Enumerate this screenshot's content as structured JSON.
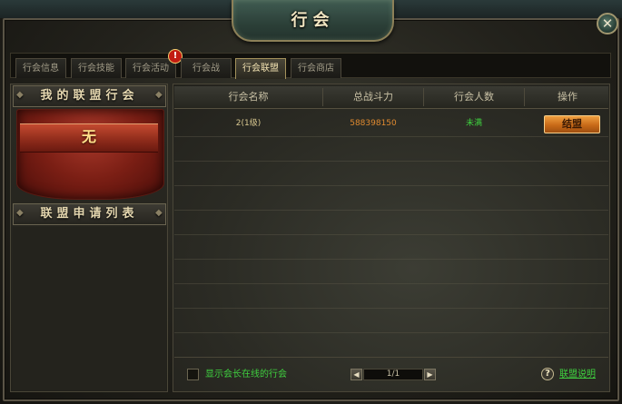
{
  "window": {
    "title": "行会",
    "close_symbol": "✕"
  },
  "tabs": [
    {
      "label": "行会信息",
      "active": false
    },
    {
      "label": "行会技能",
      "active": false
    },
    {
      "label": "行会活动",
      "active": false,
      "alert": "!"
    },
    {
      "label": "行会战",
      "active": false
    },
    {
      "label": "行会联盟",
      "active": true
    },
    {
      "label": "行会商店",
      "active": false
    }
  ],
  "sidebar": {
    "my_alliance_title": "我的联盟行会",
    "my_alliance_value": "无",
    "apply_list_title": "联盟申请列表"
  },
  "table": {
    "headers": [
      "行会名称",
      "总战斗力",
      "行会人数",
      "操作"
    ],
    "rows": [
      {
        "name": "2(1级)",
        "power": "588398150",
        "members": "未满",
        "action": "结盟"
      }
    ],
    "colors": {
      "name": "#d8c890",
      "power": "#e08a30",
      "members": "#3fcf3f"
    }
  },
  "footer": {
    "checkbox_label": "显示会长在线的行会",
    "checkbox_checked": false,
    "pagination": {
      "prev": "◀",
      "next": "▶",
      "text": "1/1"
    },
    "help_symbol": "?",
    "help_link": "联盟说明"
  },
  "icons": [
    "close-icon",
    "alert-icon",
    "prev-arrow-icon",
    "next-arrow-icon",
    "help-icon"
  ]
}
